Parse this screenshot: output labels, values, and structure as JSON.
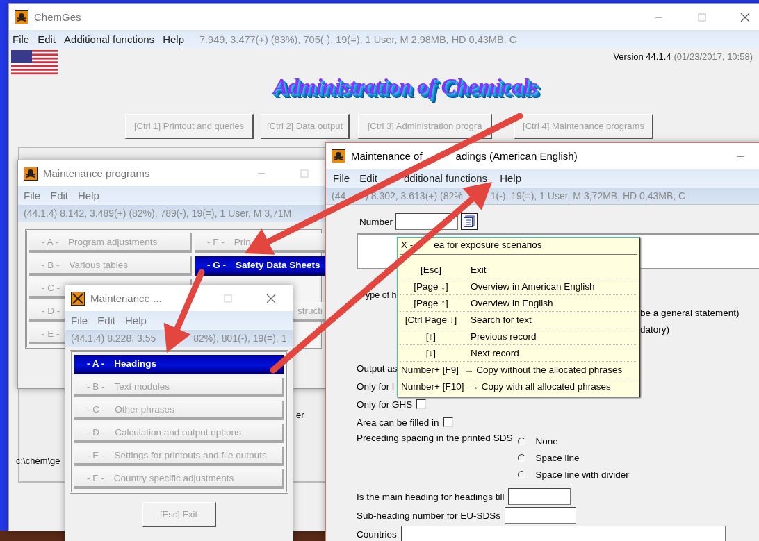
{
  "main_window": {
    "title": "ChemGes",
    "menu": [
      "File",
      "Edit",
      "Additional functions",
      "Help"
    ],
    "status": "7.949, 3.477(+) (83%), 705(-), 19(=), 1 User, M 2,98MB, HD 0,43MB, C",
    "version": "Version 44.1.4",
    "version_date": "(01/23/2017, 10:58)",
    "logo": "Administration of Chemicals",
    "buttons": [
      "[Ctrl 1] Printout and queries",
      "[Ctrl 2] Data output",
      "[Ctrl 3] Administration progra",
      "[Ctrl 4] Maintenance programs"
    ],
    "path": "c:\\chem\\ge",
    "fragment": "er"
  },
  "programs_window": {
    "title": "Maintenance programs",
    "menu": [
      "File",
      "Edit",
      "Help"
    ],
    "status": "(44.1.4) 8.142, 3.489(+) (82%), 789(-), 19(=), 1 User, M 3,71M",
    "buttons_left": [
      {
        "key": "- A -",
        "label": "Program adjustments",
        "selected": false
      },
      {
        "key": "- B -",
        "label": "Various tables",
        "selected": false
      },
      {
        "key": "- C -",
        "selected": false
      },
      {
        "key": "- D -",
        "selected": false
      },
      {
        "key": "- E -",
        "selected": false
      }
    ],
    "buttons_right": [
      {
        "key": "- F -",
        "label": "Prin",
        "selected": false
      },
      {
        "key": "- G -",
        "label": "Safety Data Sheets",
        "selected": true
      },
      {
        "label": "structi",
        "selected": false
      }
    ]
  },
  "small_window": {
    "title": "Maintenance ...",
    "menu": [
      "File",
      "Edit",
      "Help"
    ],
    "status_parts": [
      "(44.1.4) 8.228, 3.55",
      "82%), 801(-), 19(=), 1"
    ],
    "buttons": [
      {
        "key": "- A -",
        "label": "Headings",
        "selected": true
      },
      {
        "key": "- B -",
        "label": "Text modules",
        "selected": false
      },
      {
        "key": "- C -",
        "label": "Other phrases",
        "selected": false
      },
      {
        "key": "- D -",
        "label": "Calculation and output options",
        "selected": false
      },
      {
        "key": "- E -",
        "label": "Settings for printouts and file outputs",
        "selected": false
      },
      {
        "key": "- F -",
        "label": "Country specific adjustments",
        "selected": false
      }
    ],
    "exit_button": "[Esc] Exit"
  },
  "headings_window": {
    "title_parts": [
      "Maintenance of",
      "adings (American English)"
    ],
    "menu": [
      "File",
      "Edit",
      "dditional functions",
      "Help"
    ],
    "status_parts": [
      "(44",
      ") 8.302, 3.613(+) (82%",
      "1(-), 19(=), 1 User, M 3,72MB, HD 0,43MB, C"
    ],
    "number_label": "Number",
    "type_label": "ype of h",
    "type_fragments": [
      "be a general statement)",
      "datory)"
    ],
    "output_label": "Output as",
    "only_label": "Only for l",
    "checkboxes": [
      {
        "label": "Only for GHS",
        "checked": false
      },
      {
        "label": "Area can be filled in",
        "checked": false
      }
    ],
    "spacing": {
      "label": "Preceding spacing in the printed SDS",
      "options": [
        {
          "label": "None",
          "selected": false
        },
        {
          "label": "Space line",
          "selected": false
        },
        {
          "label": "Space line with divider",
          "selected": false
        }
      ]
    },
    "fields": [
      {
        "label": "Is the main heading for headings till"
      },
      {
        "label": "Sub-heading number for EU-SDSs"
      },
      {
        "label": "Countries"
      }
    ],
    "tooltip": {
      "title_parts": [
        "X -",
        "ea for exposure scenarios"
      ],
      "rows": [
        {
          "kind": "key",
          "key": "[Esc]",
          "action": "Exit"
        },
        {
          "kind": "key",
          "key": "[Page ↓]",
          "action": "Overview in American English"
        },
        {
          "kind": "key",
          "key": "[Page ↑]",
          "action": "Overview in English"
        },
        {
          "kind": "key",
          "key": "[Ctrl Page ↓]",
          "action": "Search for text"
        },
        {
          "kind": "key",
          "key": "[↑]",
          "action": "Previous record"
        },
        {
          "kind": "key",
          "key": "[↓]",
          "action": "Next record"
        },
        {
          "kind": "copy",
          "key": "Number+ [F9]",
          "action": "→ Copy without the allocated phrases"
        },
        {
          "kind": "copy",
          "key": "Number+ [F10]",
          "action": "→ Copy with all allocated phrases"
        }
      ]
    }
  }
}
